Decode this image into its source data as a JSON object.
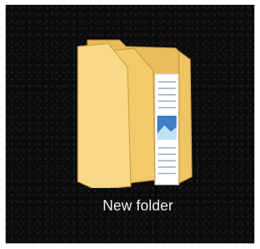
{
  "desktop": {
    "background_color": "#0b0b0b",
    "items": [
      {
        "label": "New folder",
        "icon": "folder-icon",
        "folder_color": "#f6d47f"
      }
    ]
  }
}
